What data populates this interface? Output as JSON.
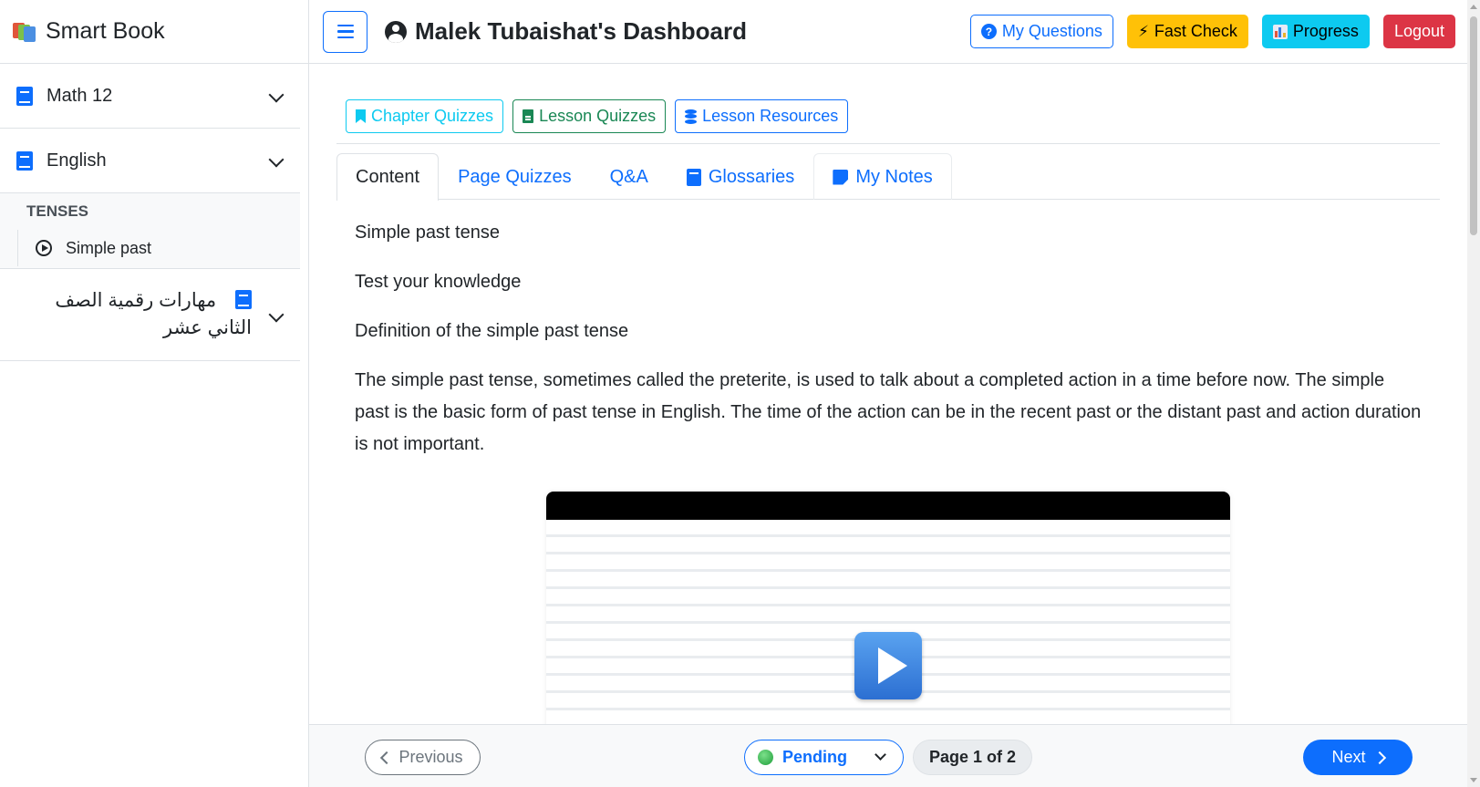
{
  "brand": {
    "title": "Smart Book"
  },
  "sidebar": {
    "courses": [
      {
        "label": "Math 12"
      },
      {
        "label": "English"
      },
      {
        "label": "مهارات رقمية الصف الثاني عشر"
      }
    ],
    "group": {
      "title": "TENSES",
      "lessons": [
        {
          "label": "Simple past"
        }
      ]
    }
  },
  "header": {
    "title": "Malek Tubaishat's Dashboard",
    "buttons": {
      "my_questions": "My Questions",
      "fast_check": "Fast Check",
      "progress": "Progress",
      "logout": "Logout"
    }
  },
  "resources": {
    "chapter_quizzes": "Chapter Quizzes",
    "lesson_quizzes": "Lesson Quizzes",
    "lesson_resources": "Lesson Resources"
  },
  "tabs": [
    {
      "label": "Content",
      "active": true
    },
    {
      "label": "Page Quizzes"
    },
    {
      "label": "Q&A"
    },
    {
      "label": "Glossaries"
    },
    {
      "label": "My Notes"
    }
  ],
  "content": {
    "lines": [
      "Simple past tense",
      "Test your knowledge",
      "Definition of the simple past tense"
    ],
    "paragraph": "The simple past tense, sometimes called the preterite, is used to talk about a completed action in a time before now. The simple past is the basic form of past tense in English. The time of the action can be in the recent past or the distant past and action duration is not important."
  },
  "footer": {
    "previous": "Previous",
    "status": "Pending",
    "page_indicator": "Page 1 of 2",
    "next": "Next"
  },
  "colors": {
    "primary": "#0d6efd",
    "warning": "#ffc107",
    "info": "#0dcaf0",
    "danger": "#dc3545",
    "success": "#198754"
  }
}
